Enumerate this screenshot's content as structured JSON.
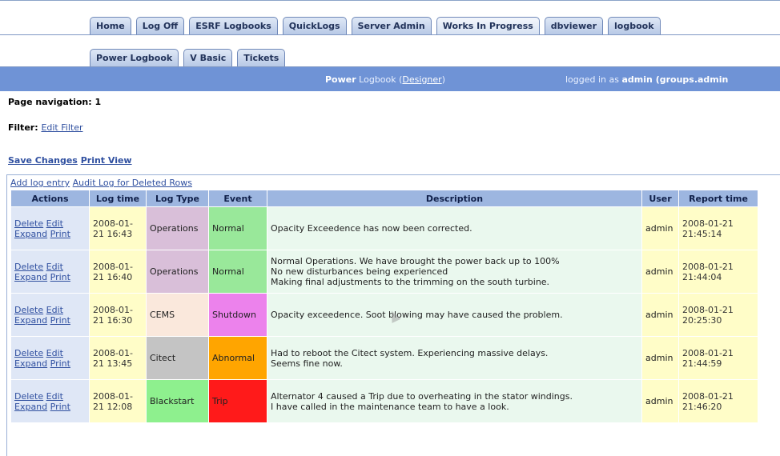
{
  "nav": {
    "tabs_row1": [
      "Home",
      "Log Off",
      "ESRF Logbooks",
      "QuickLogs",
      "Server Admin",
      "Works In Progress",
      "dbviewer",
      "logbook"
    ],
    "active_row1": "Works In Progress",
    "tabs_row2": [
      "Power Logbook",
      "V Basic",
      "Tickets"
    ]
  },
  "titlebar": {
    "title_bold": "Power",
    "title_rest": " Logbook (",
    "designer_link": "Designer",
    "title_close": ")",
    "logged_in_prefix": "logged in as ",
    "logged_in_user": "admin (groups.admin"
  },
  "page": {
    "page_nav_label": "Page navigation: 1",
    "filter_label": "Filter: ",
    "edit_filter_link": "Edit Filter",
    "save_changes": "Save Changes",
    "print_view": "Print View",
    "add_log_entry": "Add log entry",
    "audit_log": "Audit Log for Deleted Rows"
  },
  "table": {
    "headers": [
      "Actions",
      "Log time",
      "Log Type",
      "Event",
      "Description",
      "User",
      "Report time"
    ],
    "action_labels": {
      "delete": "Delete",
      "edit": "Edit",
      "expand": "Expand",
      "print": "Print"
    },
    "rows": [
      {
        "log_time_1": "2008-01-",
        "log_time_2": "21 16:43",
        "log_type": "Operations",
        "log_type_color": "#d9bfd9",
        "event": "Normal",
        "event_color": "#99e89a",
        "description": [
          "Opacity Exceedence has now been corrected."
        ],
        "user": "admin",
        "report_time_1": "2008-01-21",
        "report_time_2": "21:45:14"
      },
      {
        "log_time_1": "2008-01-",
        "log_time_2": "21 16:40",
        "log_type": "Operations",
        "log_type_color": "#d9bfd9",
        "event": "Normal",
        "event_color": "#99e89a",
        "description": [
          "Normal Operations. We have brought the power back up to 100%",
          "No new disturbances being experienced",
          "Making final adjustments to the trimming on the south turbine."
        ],
        "user": "admin",
        "report_time_1": "2008-01-21",
        "report_time_2": "21:44:04"
      },
      {
        "log_time_1": "2008-01-",
        "log_time_2": "21 16:30",
        "log_type": "CEMS",
        "log_type_color": "#fae8dc",
        "event": "Shutdown",
        "event_color": "#ec82ec",
        "description": [
          "Opacity exceedence. Soot blowing may have caused the problem."
        ],
        "user": "admin",
        "report_time_1": "2008-01-21",
        "report_time_2": "20:25:30"
      },
      {
        "log_time_1": "2008-01-",
        "log_time_2": "21 13:45",
        "log_type": "Citect",
        "log_type_color": "#c4c4c4",
        "event": "Abnormal",
        "event_color": "#ffa500",
        "description": [
          "Had to reboot the Citect system. Experiencing massive delays.",
          "Seems fine now."
        ],
        "user": "admin",
        "report_time_1": "2008-01-21",
        "report_time_2": "21:44:59"
      },
      {
        "log_time_1": "2008-01-",
        "log_time_2": "21 12:08",
        "log_type": "Blackstart",
        "log_type_color": "#8ef08e",
        "event": "Trip",
        "event_color": "#ff1a1a",
        "description": [
          "Alternator 4 caused a Trip due to overheating in the stator windings.",
          "I have called in the maintenance team to have a look."
        ],
        "user": "admin",
        "report_time_1": "2008-01-21",
        "report_time_2": "21:46:20"
      }
    ]
  }
}
